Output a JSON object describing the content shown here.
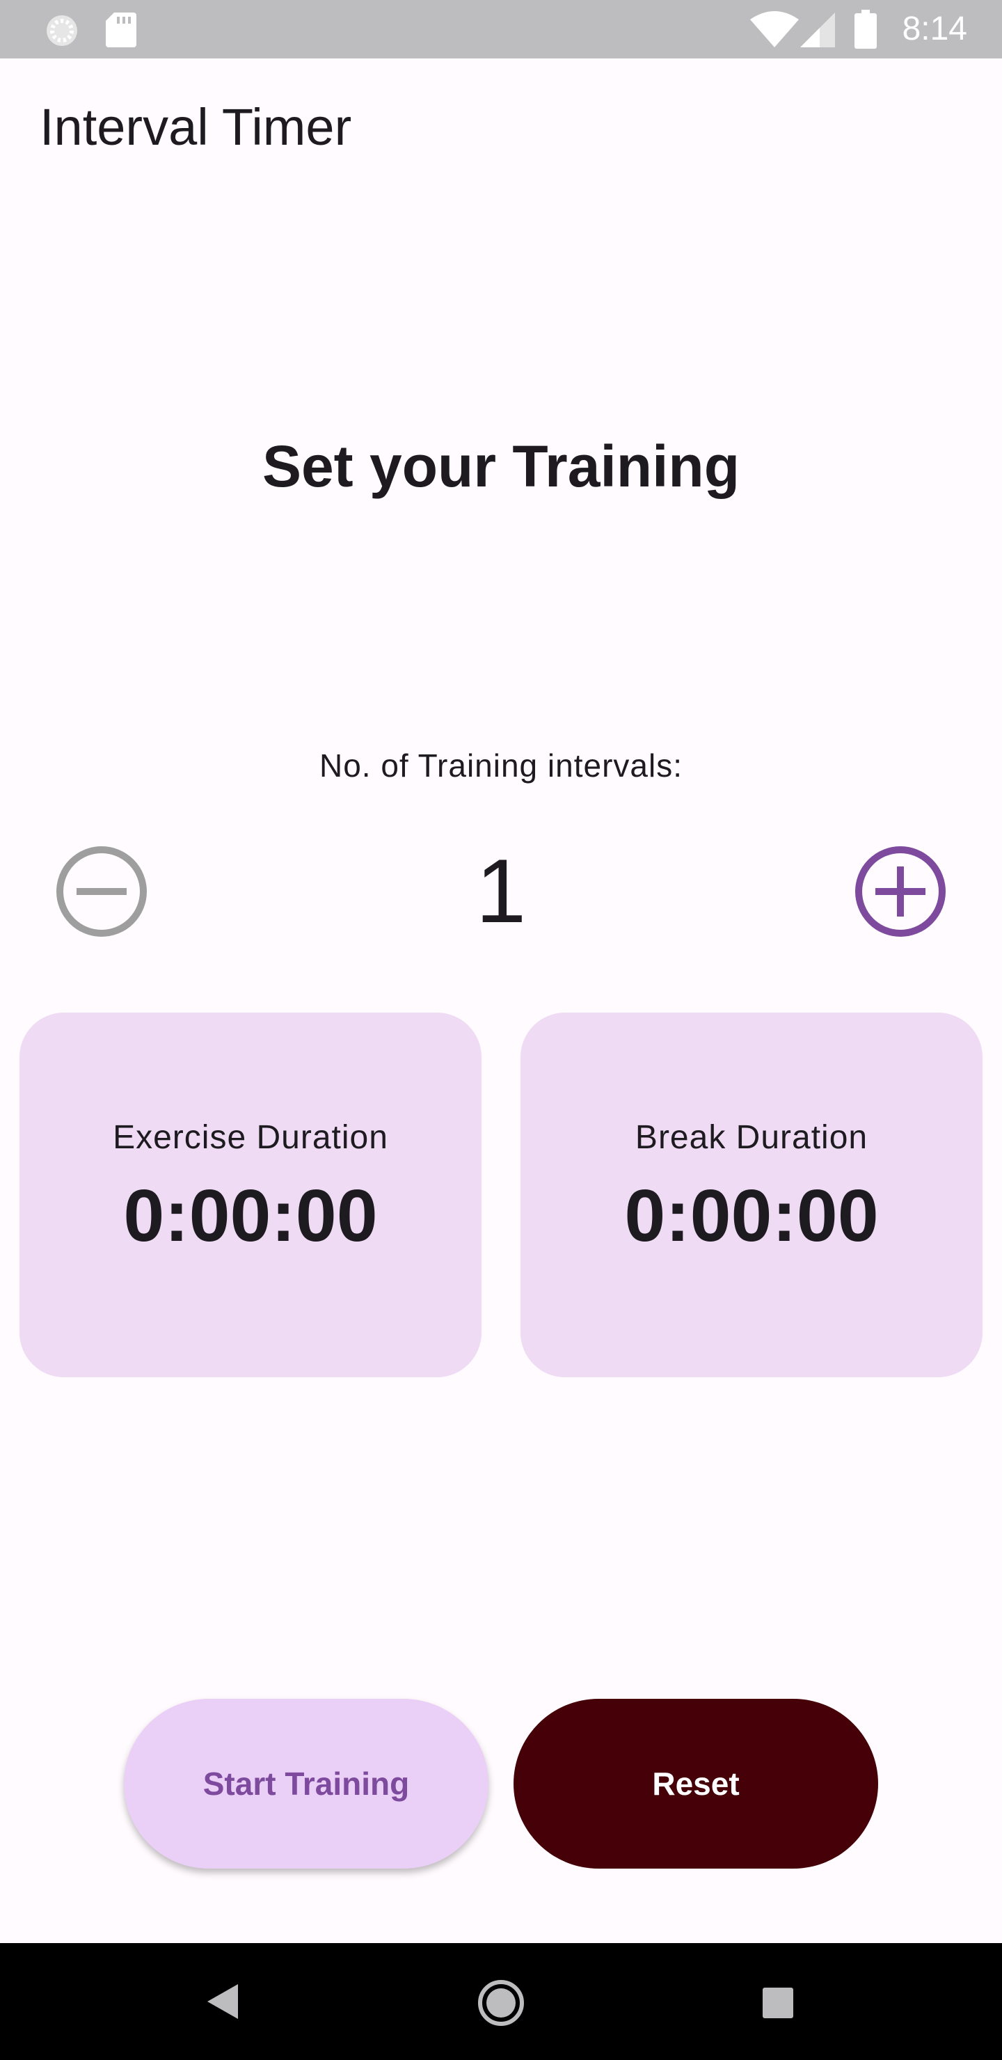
{
  "status_bar": {
    "time": "8:14",
    "icons": [
      "loading-icon",
      "sd-card-icon",
      "wifi-icon",
      "signal-icon",
      "battery-icon"
    ],
    "background": "#bdbcbe"
  },
  "app_bar": {
    "title": "Interval Timer"
  },
  "main": {
    "heading": "Set your Training",
    "intervals_label": "No. of Training intervals:",
    "interval_count": "1",
    "decrement_icon": "minus-circle-icon",
    "increment_icon": "plus-circle-icon",
    "cards": [
      {
        "label": "Exercise Duration",
        "value": "0:00:00"
      },
      {
        "label": "Break Duration",
        "value": "0:00:00"
      }
    ]
  },
  "actions": {
    "start_label": "Start Training",
    "reset_label": "Reset"
  },
  "nav_bar": {
    "icons": [
      "back-icon",
      "home-icon",
      "recents-icon"
    ]
  },
  "colors": {
    "background": "#fffbfe",
    "card": "#efdbf3",
    "accent": "#7d4a9e",
    "disabled": "#9e9e9e",
    "start_button": "#eacff6",
    "reset_button": "#450008"
  }
}
